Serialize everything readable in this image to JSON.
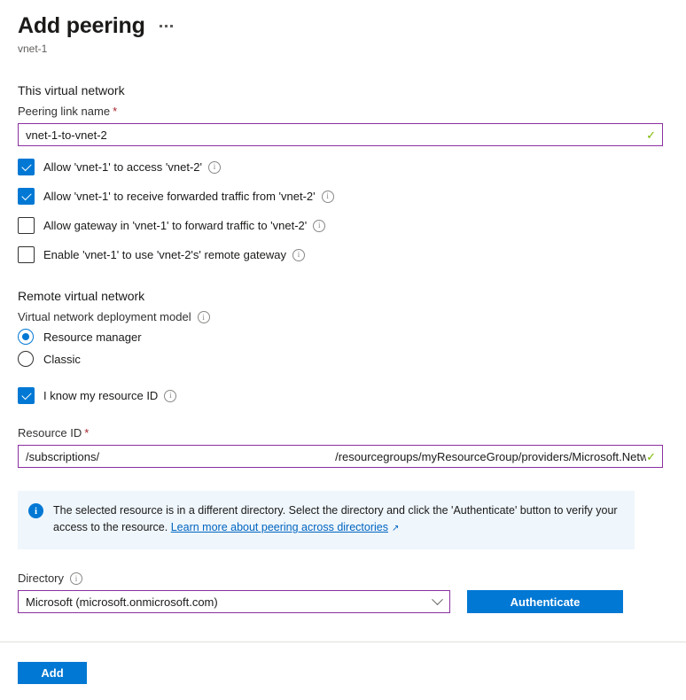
{
  "header": {
    "title": "Add peering",
    "subtitle": "vnet-1",
    "more_menu": "more-options"
  },
  "this_network": {
    "section_title": "This virtual network",
    "peering_link_name": {
      "label": "Peering link name",
      "required_mark": "*",
      "value": "vnet-1-to-vnet-2",
      "valid_mark": "✓"
    },
    "checkboxes": [
      {
        "label": "Allow 'vnet-1' to access 'vnet-2'",
        "checked": true,
        "info": "i"
      },
      {
        "label": "Allow 'vnet-1' to receive forwarded traffic from 'vnet-2'",
        "checked": true,
        "info": "i"
      },
      {
        "label": "Allow gateway in 'vnet-1' to forward traffic to 'vnet-2'",
        "checked": false,
        "info": "i"
      },
      {
        "label": "Enable 'vnet-1' to use 'vnet-2's' remote gateway",
        "checked": false,
        "info": "i"
      }
    ]
  },
  "remote_network": {
    "section_title": "Remote virtual network",
    "deployment_model": {
      "label": "Virtual network deployment model",
      "info": "i",
      "options": [
        {
          "label": "Resource manager",
          "selected": true
        },
        {
          "label": "Classic",
          "selected": false
        }
      ]
    },
    "know_resource_id": {
      "label": "I know my resource ID",
      "checked": true,
      "info": "i"
    },
    "resource_id": {
      "label": "Resource ID",
      "required_mark": "*",
      "value_prefix": "/subscriptions/",
      "value_suffix": "/resourcegroups/myResourceGroup/providers/Microsoft.Netwo...",
      "valid_mark": "✓"
    }
  },
  "banner": {
    "icon": "i",
    "text": "The selected resource is in a different directory. Select the directory and click the 'Authenticate' button to verify your access to the resource.",
    "link_text": "Learn more about peering across directories",
    "external_icon": "↗"
  },
  "directory": {
    "label": "Directory",
    "info": "i",
    "selected": "Microsoft (microsoft.onmicrosoft.com)",
    "authenticate_button": "Authenticate"
  },
  "footer": {
    "add_button": "Add"
  },
  "colors": {
    "accent_blue": "#0078d4",
    "field_border_purple": "#8b2fa0",
    "valid_green": "#7ab800",
    "banner_bg": "#eff6fc",
    "link_blue": "#0064bf",
    "required_red": "#a4262c"
  }
}
